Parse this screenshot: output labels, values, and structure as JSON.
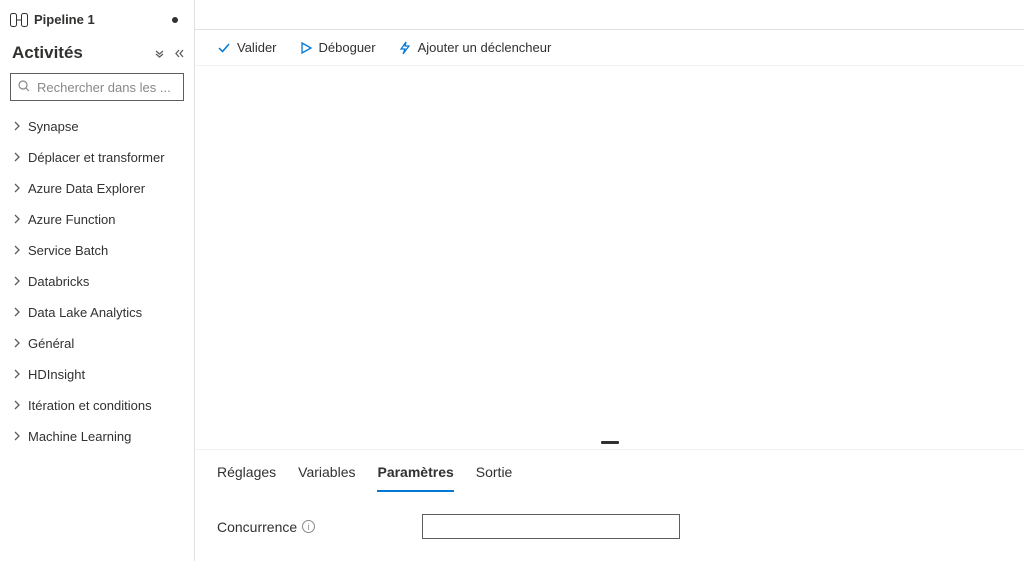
{
  "tab": {
    "label": "Pipeline 1"
  },
  "activities": {
    "title": "Activités",
    "search_placeholder": "Rechercher dans les ...",
    "items": [
      {
        "label": "Synapse"
      },
      {
        "label": "Déplacer et transformer"
      },
      {
        "label": "Azure Data Explorer"
      },
      {
        "label": "Azure Function"
      },
      {
        "label": "Service Batch"
      },
      {
        "label": "Databricks"
      },
      {
        "label": "Data Lake Analytics"
      },
      {
        "label": "Général"
      },
      {
        "label": "HDInsight"
      },
      {
        "label": "Itération et conditions"
      },
      {
        "label": "Machine Learning"
      }
    ]
  },
  "toolbar": {
    "validate": "Valider",
    "debug": "Déboguer",
    "add_trigger": "Ajouter un déclencheur"
  },
  "bottom": {
    "tabs": [
      {
        "label": "Réglages",
        "active": false
      },
      {
        "label": "Variables",
        "active": false
      },
      {
        "label": "Paramètres",
        "active": true
      },
      {
        "label": "Sortie",
        "active": false
      }
    ],
    "form": {
      "concurrency_label": "Concurrence",
      "concurrency_value": ""
    }
  }
}
